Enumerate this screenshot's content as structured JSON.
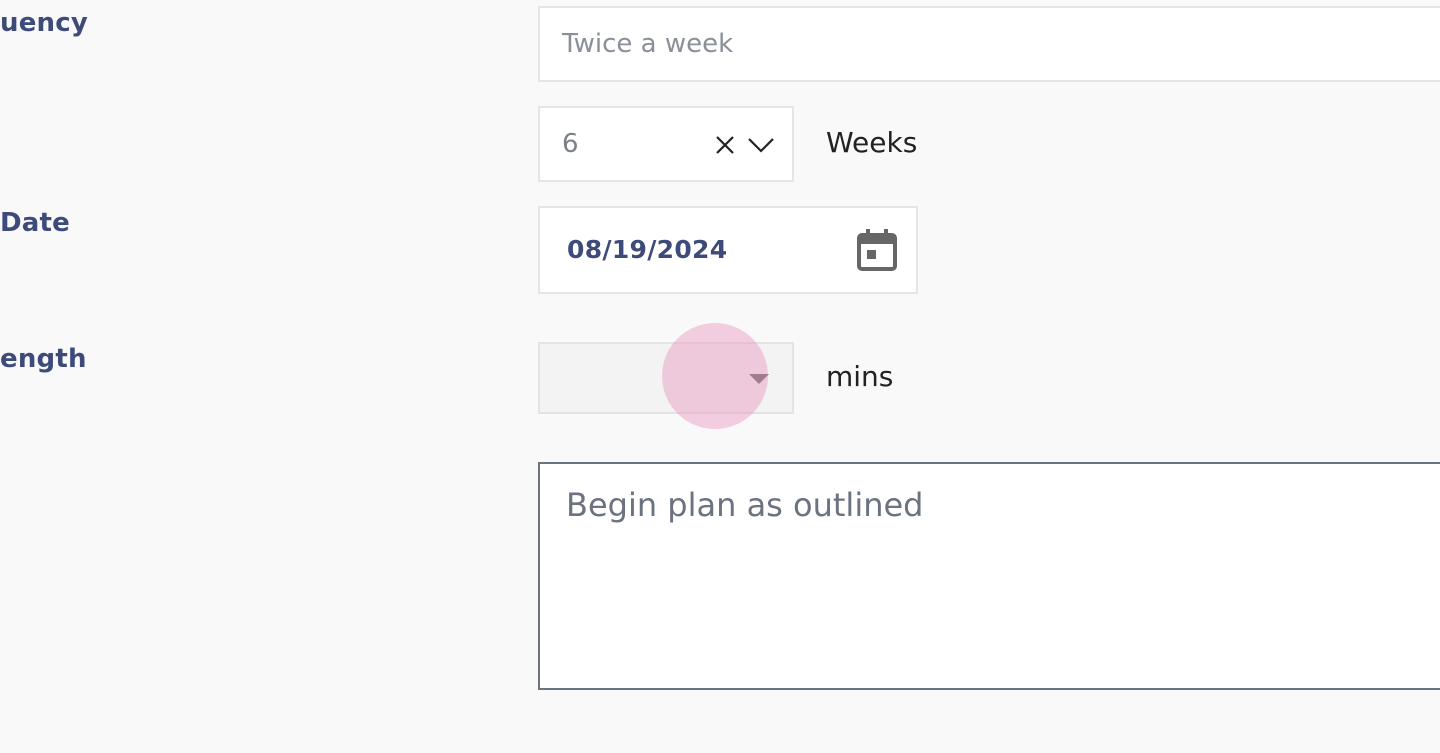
{
  "form": {
    "frequency": {
      "label": "uency",
      "value": "Twice a week"
    },
    "duration": {
      "value": "6",
      "unit": "Weeks"
    },
    "start_date": {
      "label": "Date",
      "value": "08/19/2024"
    },
    "session_length": {
      "label": "ength",
      "value": "",
      "unit": "mins"
    },
    "notes": {
      "value": "Begin plan as outlined"
    }
  },
  "icons": {
    "clear": "close-icon",
    "dropdown": "chevron-down-icon",
    "calendar": "calendar-icon",
    "caret": "caret-down-icon"
  },
  "colors": {
    "label": "#3d4a7a",
    "background": "#f9f9fa",
    "click_indicator": "#e996be"
  }
}
